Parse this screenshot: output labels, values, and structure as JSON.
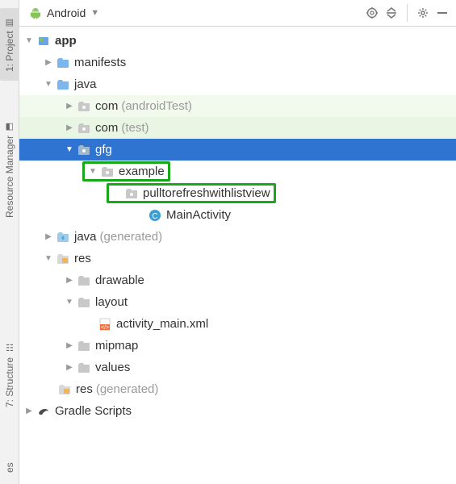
{
  "sidebar_tabs": {
    "project": "1: Project",
    "resource_manager": "Resource Manager",
    "structure": "7: Structure",
    "favorites": "es"
  },
  "header": {
    "view_selector": "Android"
  },
  "tree": {
    "app": "app",
    "manifests": "manifests",
    "java": "java",
    "com1": "com",
    "com1_suffix": "(androidTest)",
    "com2": "com",
    "com2_suffix": "(test)",
    "gfg": "gfg",
    "example": "example",
    "pkg": "pulltorefreshwithlistview",
    "main_activity": "MainActivity",
    "java_gen": "java",
    "java_gen_suffix": "(generated)",
    "res": "res",
    "drawable": "drawable",
    "layout": "layout",
    "activity_main": "activity_main.xml",
    "mipmap": "mipmap",
    "values": "values",
    "res_gen": "res",
    "res_gen_suffix": "(generated)",
    "gradle": "Gradle Scripts"
  }
}
